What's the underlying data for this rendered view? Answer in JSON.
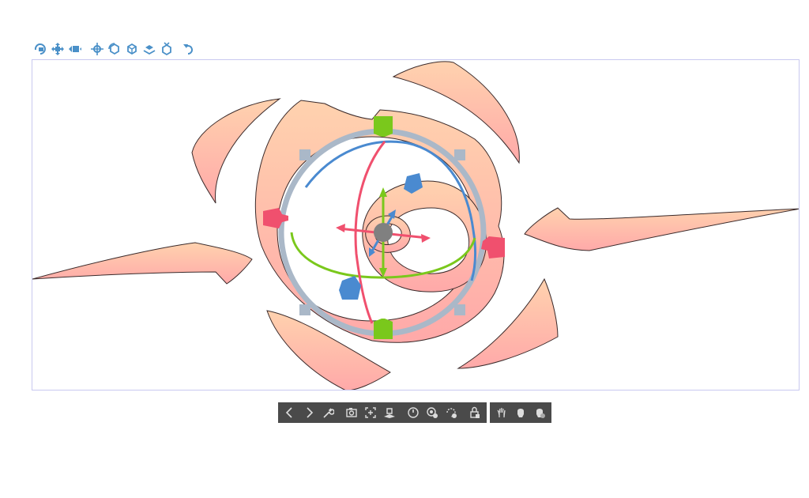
{
  "colors": {
    "tool_icon": "#4a90c8",
    "viewport_border": "#c8c8f0",
    "shape_fill_top": "#ffcfae",
    "shape_fill_bottom": "#ffadad",
    "ring": "#aab8c8",
    "gizmo_green": "#7ac81c",
    "gizmo_red": "#f0506e",
    "gizmo_blue": "#4a8ad0",
    "pivot": "#808080",
    "bar_bg": "#4a4a4a",
    "bar_icon": "#dddddd"
  },
  "top_toolbar": [
    {
      "name": "rotate-camera-icon"
    },
    {
      "name": "pan-camera-icon"
    },
    {
      "name": "move-camera-icon"
    },
    {
      "name": "move-object-icon"
    },
    {
      "name": "rotate-object-icon"
    },
    {
      "name": "rotate-object-axis-icon"
    },
    {
      "name": "move-object-plane-icon"
    },
    {
      "name": "scale-object-icon"
    },
    {
      "name": "undo-camera-icon"
    }
  ],
  "bottom_toolbar": {
    "main_group": [
      {
        "name": "previous-icon"
      },
      {
        "name": "next-icon"
      },
      {
        "name": "wrench-icon"
      },
      {
        "name": "camera-icon"
      },
      {
        "name": "fit-selection-icon"
      },
      {
        "name": "ground-icon"
      },
      {
        "name": "reset-pose-icon"
      },
      {
        "name": "reset-angle-icon"
      },
      {
        "name": "reset-rotation-icon"
      },
      {
        "name": "lock-icon"
      }
    ],
    "extra_group": [
      {
        "name": "pose-left-hand-icon"
      },
      {
        "name": "pose-hand-icon"
      },
      {
        "name": "pose-right-hand-icon"
      }
    ]
  }
}
